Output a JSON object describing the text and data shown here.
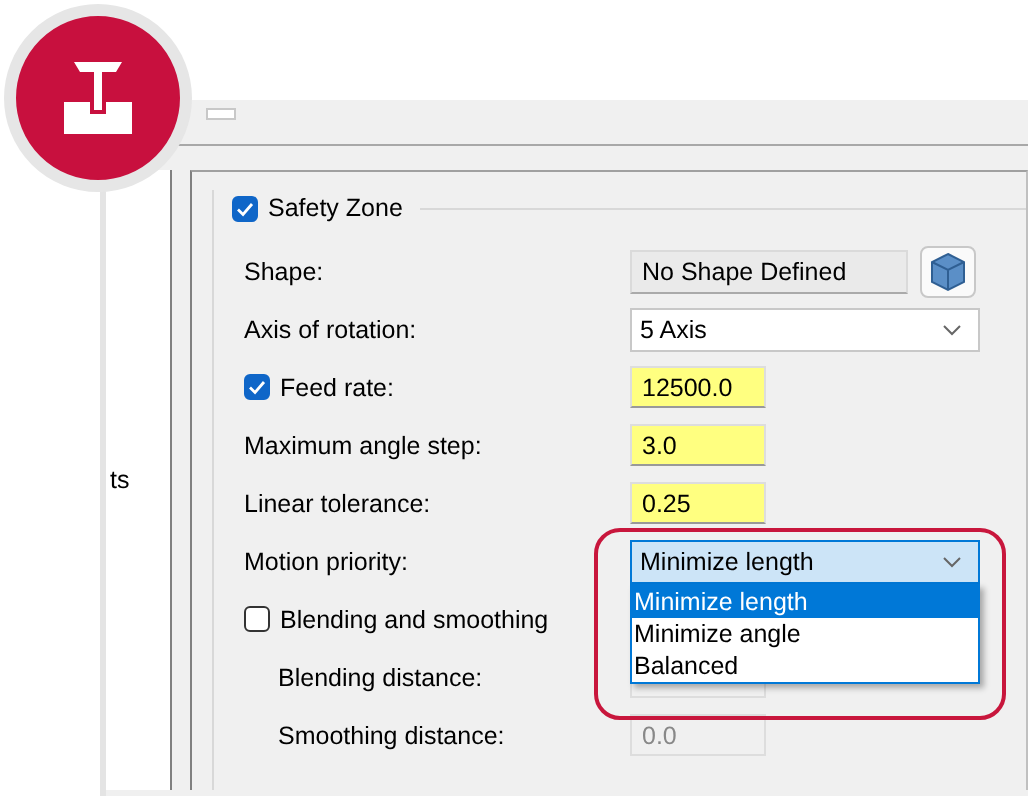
{
  "side_panel": {
    "text": "ts"
  },
  "group": {
    "title": "Safety Zone",
    "checked": true
  },
  "rows": [
    {
      "kind": "shape",
      "label": "Shape:",
      "value": "No Shape Defined"
    },
    {
      "kind": "dropdown",
      "label": "Axis of rotation:",
      "value": "5 Axis",
      "expanded": false
    },
    {
      "kind": "checkfield",
      "label": "Feed rate:",
      "checked": true,
      "value": "12500.0",
      "highlighted": true
    },
    {
      "kind": "field",
      "label": "Maximum angle step:",
      "value": "3.0",
      "highlighted": true
    },
    {
      "kind": "field",
      "label": "Linear tolerance:",
      "value": "0.25",
      "highlighted": true
    },
    {
      "kind": "dropdown",
      "label": "Motion priority:",
      "value": "Minimize length",
      "expanded": true,
      "options": [
        {
          "label": "Minimize length",
          "selected": true
        },
        {
          "label": "Minimize angle",
          "selected": false
        },
        {
          "label": "Balanced",
          "selected": false
        }
      ]
    },
    {
      "kind": "checkbox",
      "label": "Blending and smoothing",
      "checked": false
    },
    {
      "kind": "subfield",
      "label": "Blending distance:",
      "disabled": true
    },
    {
      "kind": "subfield",
      "label": "Smoothing distance:",
      "value": "0.0",
      "disabled": true
    }
  ]
}
